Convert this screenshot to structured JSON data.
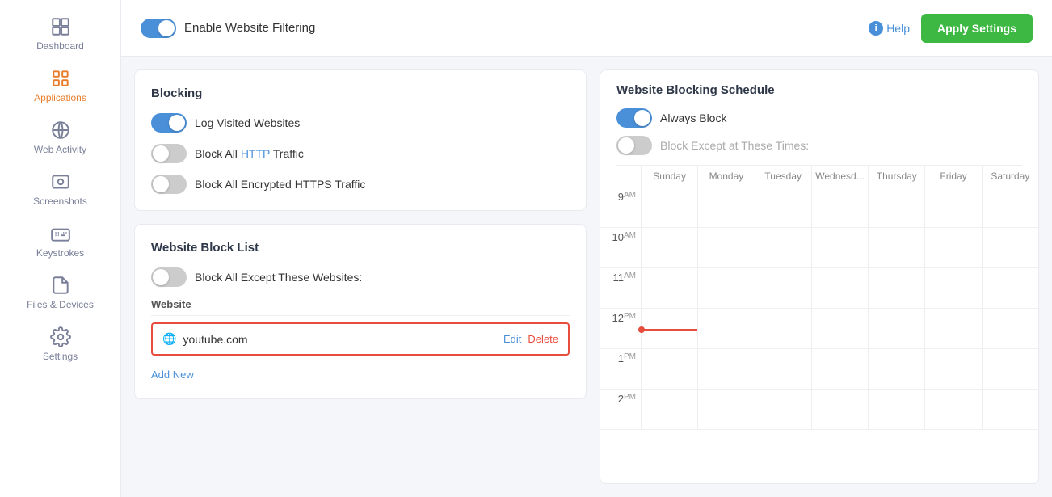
{
  "sidebar": {
    "items": [
      {
        "id": "dashboard",
        "label": "Dashboard",
        "icon": "dashboard"
      },
      {
        "id": "applications",
        "label": "Applications",
        "icon": "applications",
        "active": true
      },
      {
        "id": "web-activity",
        "label": "Web Activity",
        "icon": "globe"
      },
      {
        "id": "screenshots",
        "label": "Screenshots",
        "icon": "screenshots"
      },
      {
        "id": "keystrokes",
        "label": "Keystrokes",
        "icon": "keyboard"
      },
      {
        "id": "files-devices",
        "label": "Files & Devices",
        "icon": "files"
      },
      {
        "id": "settings",
        "label": "Settings",
        "icon": "settings"
      }
    ]
  },
  "topbar": {
    "toggle_label": "Enable Website Filtering",
    "toggle_on": true,
    "help_label": "Help",
    "apply_label": "Apply Settings"
  },
  "blocking": {
    "title": "Blocking",
    "options": [
      {
        "id": "log-visited",
        "label": "Log Visited Websites",
        "on": true
      },
      {
        "id": "block-http",
        "label": "Block All HTTP Traffic",
        "on": false
      },
      {
        "id": "block-https",
        "label": "Block All Encrypted HTTPS Traffic",
        "on": false
      }
    ]
  },
  "block_list": {
    "title": "Website Block List",
    "block_except_toggle": false,
    "block_except_label": "Block All Except These Websites:",
    "column_header": "Website",
    "entries": [
      {
        "domain": "youtube.com",
        "edit_label": "Edit",
        "delete_label": "Delete"
      }
    ],
    "add_new_label": "Add New"
  },
  "schedule": {
    "title": "Website Blocking Schedule",
    "always_block_label": "Always Block",
    "always_block_on": true,
    "block_except_label": "Block Except at These Times:",
    "block_except_on": false,
    "days": [
      "Sunday",
      "Monday",
      "Tuesday",
      "Wednesd...",
      "Thursday",
      "Friday",
      "Saturday"
    ],
    "times": [
      {
        "hour": "9",
        "ampm": "AM"
      },
      {
        "hour": "10",
        "ampm": "AM"
      },
      {
        "hour": "11",
        "ampm": "AM"
      },
      {
        "hour": "12",
        "ampm": "PM"
      },
      {
        "hour": "1",
        "ampm": "PM"
      },
      {
        "hour": "2",
        "ampm": "PM"
      }
    ]
  }
}
